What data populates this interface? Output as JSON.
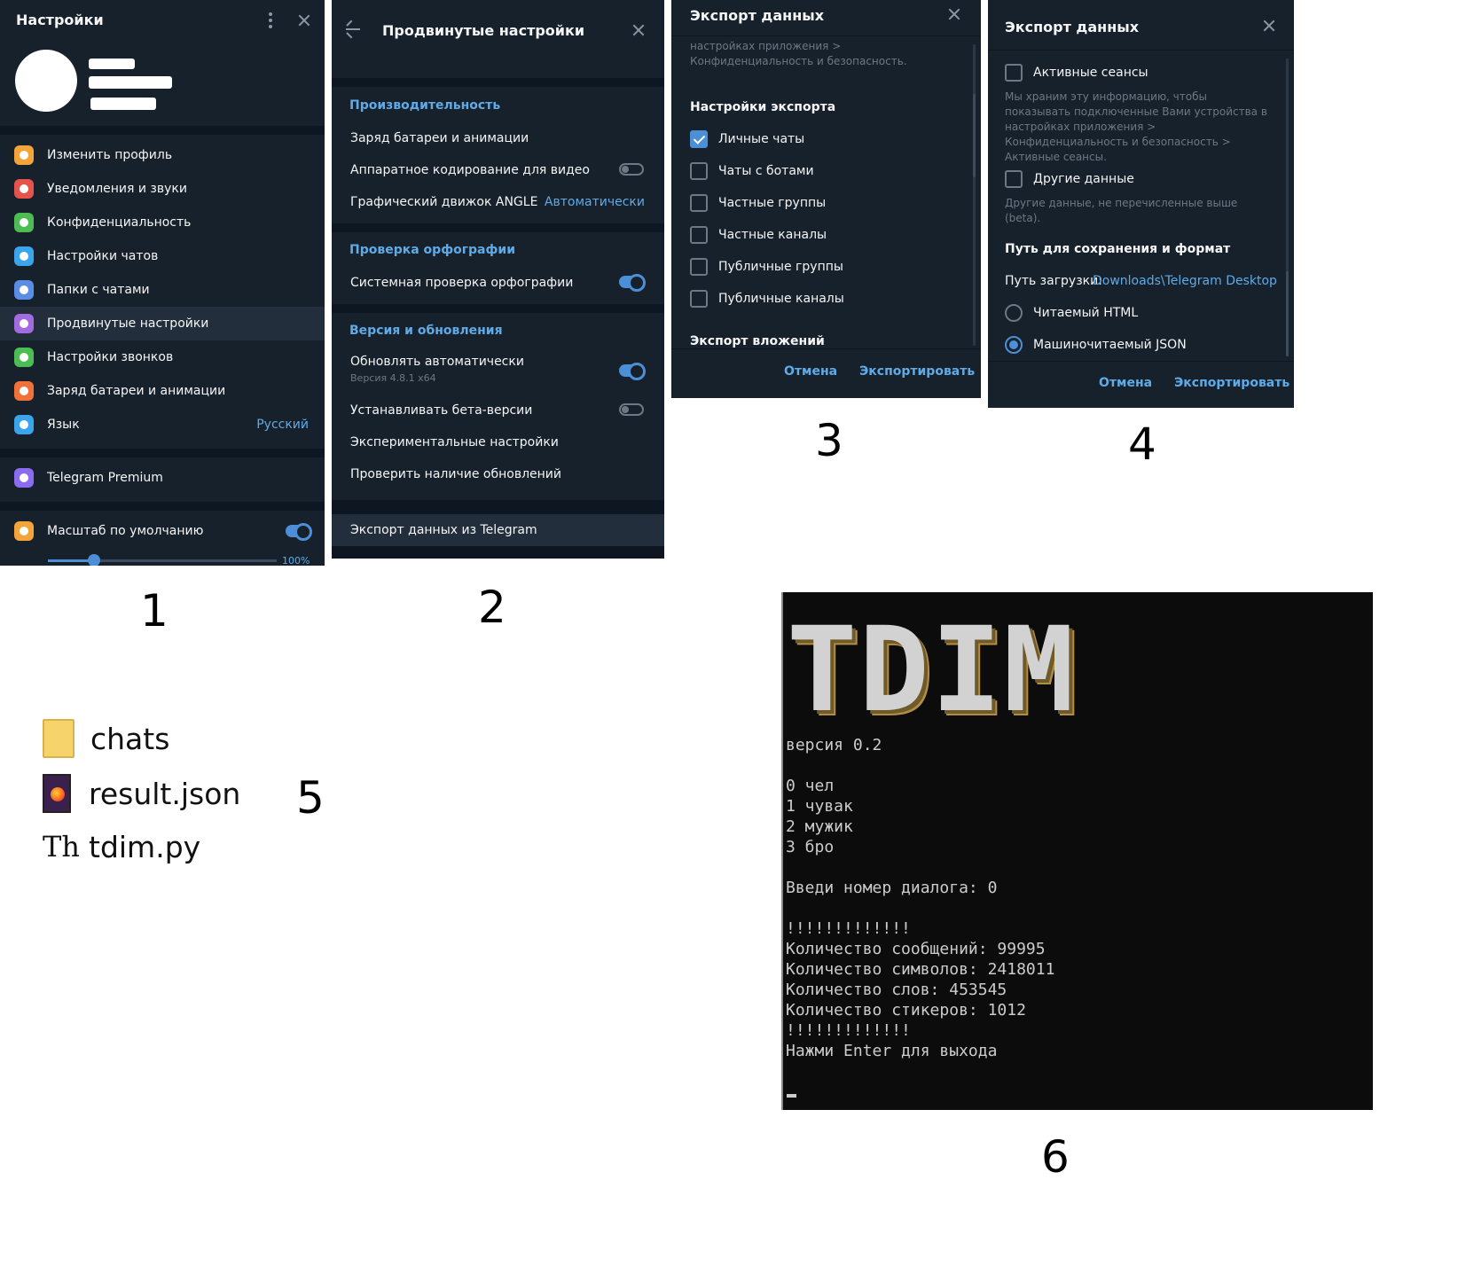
{
  "panel1": {
    "title": "Настройки",
    "menu": [
      {
        "label": "Изменить профиль",
        "color": "#f2a33a",
        "icon": "user-icon"
      },
      {
        "label": "Уведомления и звуки",
        "color": "#e5534b",
        "icon": "bell-icon"
      },
      {
        "label": "Конфиденциальность",
        "color": "#4bbd53",
        "icon": "lock-icon"
      },
      {
        "label": "Настройки чатов",
        "color": "#3aa5ea",
        "icon": "chat-bubble-icon"
      },
      {
        "label": "Папки с чатами",
        "color": "#5a8de6",
        "icon": "folder-icon"
      },
      {
        "label": "Продвинутые настройки",
        "color": "#a36be0",
        "icon": "pie-chart-icon"
      },
      {
        "label": "Настройки звонков",
        "color": "#4bbd53",
        "icon": "phone-icon"
      },
      {
        "label": "Заряд батареи и анимации",
        "color": "#f0713a",
        "icon": "battery-icon"
      },
      {
        "label": "Язык",
        "color": "#3aa5ea",
        "icon": "globe-icon",
        "value": "Русский"
      }
    ],
    "premium": "Telegram Premium",
    "premium_color": "#8b6cf0",
    "scale_label": "Масштаб по умолчанию",
    "scale_color": "#f2a33a",
    "scale_value": "100%",
    "scale_fraction": 0.2
  },
  "panel2": {
    "title": "Продвинутые настройки",
    "perf_header": "Производительность",
    "perf_items": [
      "Заряд батареи и анимации",
      "Аппаратное кодирование для видео",
      "Графический движок ANGLE"
    ],
    "angle_value": "Автоматически",
    "spell_header": "Проверка орфографии",
    "spell_item": "Системная проверка орфографии",
    "version_header": "Версия и обновления",
    "auto_update": "Обновлять автоматически",
    "version_sub": "Версия 4.8.1 x64",
    "beta": "Устанавливать бета-версии",
    "experimental": "Экспериментальные настройки",
    "check_updates": "Проверить наличие обновлений",
    "export": "Экспорт данных из Telegram"
  },
  "panel3": {
    "title": "Экспорт данных",
    "top_text": "настройках приложения > Конфиденциальность и безопасность.",
    "section": "Настройки экспорта",
    "options": [
      {
        "label": "Личные чаты",
        "checked": true
      },
      {
        "label": "Чаты с ботами",
        "checked": false
      },
      {
        "label": "Частные группы",
        "checked": false
      },
      {
        "label": "Частные каналы",
        "checked": false
      },
      {
        "label": "Публичные группы",
        "checked": false
      },
      {
        "label": "Публичные каналы",
        "checked": false
      }
    ],
    "attachments": "Экспорт вложений",
    "cancel": "Отмена",
    "export": "Экспортировать"
  },
  "panel4": {
    "title": "Экспорт данных",
    "sessions": "Активные сеансы",
    "sessions_desc": "Мы храним эту информацию, чтобы показывать подключенные Вами устройства в настройках приложения > Конфиденциальность и безопасность > Активные сеансы.",
    "other": "Другие данные",
    "other_desc": "Другие данные, не перечисленные выше (beta).",
    "path_header": "Путь для сохранения и формат",
    "path_label": "Путь загрузки:",
    "path_value": "Downloads\\Telegram Desktop",
    "format_html": "Читаемый HTML",
    "format_json": "Машиночитаемый JSON",
    "cancel": "Отмена",
    "export": "Экспортировать"
  },
  "steps": [
    "1",
    "2",
    "3",
    "4",
    "5",
    "6"
  ],
  "files": [
    "chats",
    "result.json",
    "tdim.py"
  ],
  "console": {
    "logo": "TDIM",
    "version": "версия 0.2",
    "dialogs": [
      "0 чел",
      "1 чувак",
      "2 мужик",
      "3 бро"
    ],
    "prompt": "Введи номер диалога: 0",
    "separator": "!!!!!!!!!!!!!",
    "stats": [
      "Количество сообщений: 99995",
      "Количество символов: 2418011",
      "Количество слов: 453545",
      "Количество стикеров: 1012"
    ],
    "separator2": "!!!!!!!!!!!!!",
    "exit": "Нажми Enter для выхода"
  }
}
